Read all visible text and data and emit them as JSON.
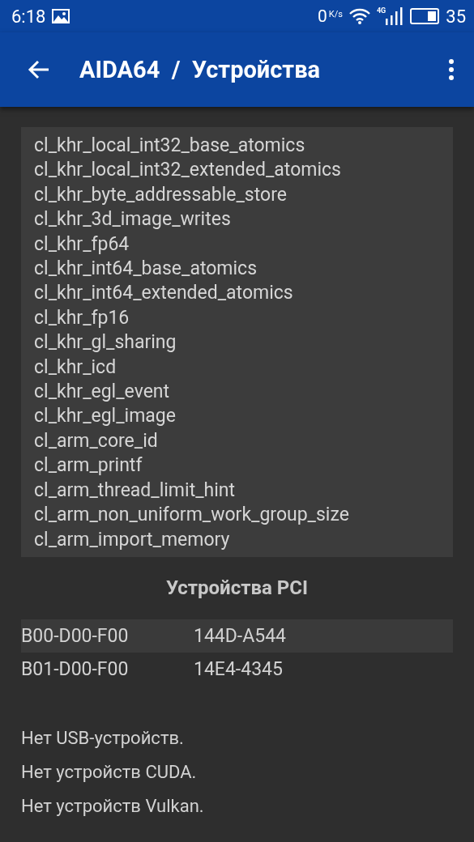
{
  "status_bar": {
    "time": "6:18",
    "speed": "0",
    "speed_unit": "K/s",
    "network": "4G",
    "battery": "35"
  },
  "app_bar": {
    "title": "AIDA64  /  Устройства"
  },
  "extensions": [
    "cl_khr_local_int32_base_atomics",
    "cl_khr_local_int32_extended_atomics",
    "cl_khr_byte_addressable_store",
    "cl_khr_3d_image_writes",
    "cl_khr_fp64",
    "cl_khr_int64_base_atomics",
    "cl_khr_int64_extended_atomics",
    "cl_khr_fp16",
    "cl_khr_gl_sharing",
    "cl_khr_icd",
    "cl_khr_egl_event",
    "cl_khr_egl_image",
    "cl_arm_core_id",
    "cl_arm_printf",
    "cl_arm_thread_limit_hint",
    "cl_arm_non_uniform_work_group_size",
    "cl_arm_import_memory"
  ],
  "pci": {
    "title": "Устройства PCI",
    "rows": [
      {
        "address": "B00-D00-F00",
        "id": "144D-A544"
      },
      {
        "address": "B01-D00-F00",
        "id": "14E4-4345"
      }
    ]
  },
  "notes": [
    "Нет USB-устройств.",
    "Нет устройств CUDA.",
    "Нет устройств Vulkan."
  ]
}
